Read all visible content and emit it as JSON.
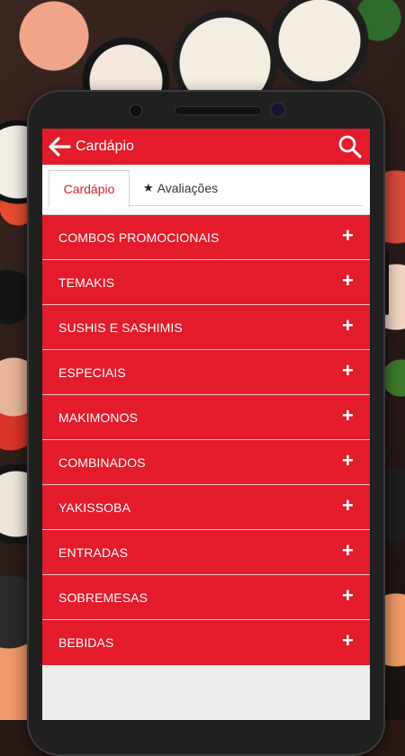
{
  "header": {
    "title": "Cardápio"
  },
  "tabs": [
    {
      "label": "Cardápio",
      "active": true
    },
    {
      "label": "Avaliações",
      "icon": "star-icon"
    }
  ],
  "menu": {
    "items": [
      "COMBOS PROMOCIONAIS",
      "TEMAKIS",
      "SUSHIS E SASHIMIS",
      "ESPECIAIS",
      "MAKIMONOS",
      "COMBINADOS",
      "YAKISSOBA",
      "ENTRADAS",
      "SOBREMESAS",
      "BEBIDAS"
    ],
    "expand_symbol": "+"
  },
  "colors": {
    "accent": "#e31b2b",
    "tab_active": "#e31b2b"
  }
}
